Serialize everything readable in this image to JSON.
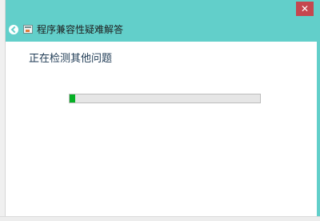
{
  "window": {
    "title": "程序兼容性疑难解答",
    "close_glyph": "✕",
    "accent_color": "#62cfca",
    "close_color": "#c5474f"
  },
  "icons": {
    "back": "back-arrow-icon",
    "app": "troubleshooter-app-icon"
  },
  "main": {
    "status_heading": "正在检测其他问题",
    "progress": {
      "fraction": 0.03,
      "fill_color": "#06b025"
    }
  }
}
